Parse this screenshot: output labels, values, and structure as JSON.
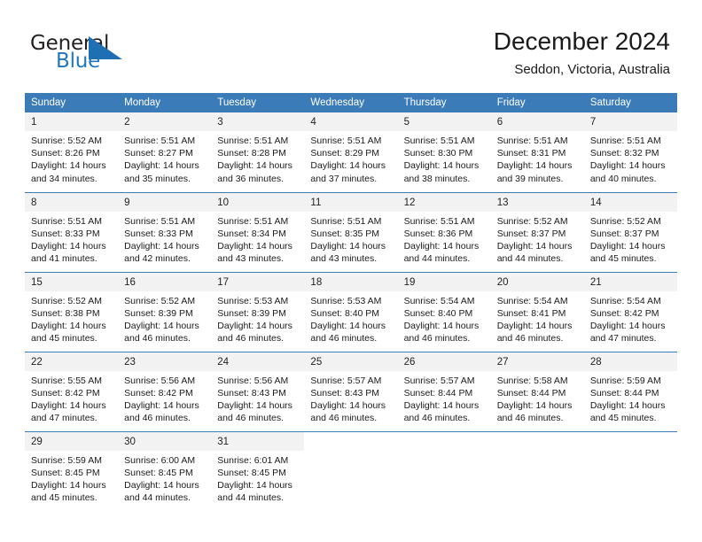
{
  "brand": {
    "name_part1": "General",
    "name_part2": "Blue",
    "accent_color": "#1f77c0",
    "triangle_icon": "triangle-icon"
  },
  "header": {
    "title": "December 2024",
    "location": "Seddon, Victoria, Australia"
  },
  "calendar": {
    "header_bg": "#3b7cb8",
    "daynum_bg": "#f2f2f2",
    "weekdays": [
      "Sunday",
      "Monday",
      "Tuesday",
      "Wednesday",
      "Thursday",
      "Friday",
      "Saturday"
    ],
    "weeks": [
      [
        {
          "day": "1",
          "sunrise": "Sunrise: 5:52 AM",
          "sunset": "Sunset: 8:26 PM",
          "daylight1": "Daylight: 14 hours",
          "daylight2": "and 34 minutes."
        },
        {
          "day": "2",
          "sunrise": "Sunrise: 5:51 AM",
          "sunset": "Sunset: 8:27 PM",
          "daylight1": "Daylight: 14 hours",
          "daylight2": "and 35 minutes."
        },
        {
          "day": "3",
          "sunrise": "Sunrise: 5:51 AM",
          "sunset": "Sunset: 8:28 PM",
          "daylight1": "Daylight: 14 hours",
          "daylight2": "and 36 minutes."
        },
        {
          "day": "4",
          "sunrise": "Sunrise: 5:51 AM",
          "sunset": "Sunset: 8:29 PM",
          "daylight1": "Daylight: 14 hours",
          "daylight2": "and 37 minutes."
        },
        {
          "day": "5",
          "sunrise": "Sunrise: 5:51 AM",
          "sunset": "Sunset: 8:30 PM",
          "daylight1": "Daylight: 14 hours",
          "daylight2": "and 38 minutes."
        },
        {
          "day": "6",
          "sunrise": "Sunrise: 5:51 AM",
          "sunset": "Sunset: 8:31 PM",
          "daylight1": "Daylight: 14 hours",
          "daylight2": "and 39 minutes."
        },
        {
          "day": "7",
          "sunrise": "Sunrise: 5:51 AM",
          "sunset": "Sunset: 8:32 PM",
          "daylight1": "Daylight: 14 hours",
          "daylight2": "and 40 minutes."
        }
      ],
      [
        {
          "day": "8",
          "sunrise": "Sunrise: 5:51 AM",
          "sunset": "Sunset: 8:33 PM",
          "daylight1": "Daylight: 14 hours",
          "daylight2": "and 41 minutes."
        },
        {
          "day": "9",
          "sunrise": "Sunrise: 5:51 AM",
          "sunset": "Sunset: 8:33 PM",
          "daylight1": "Daylight: 14 hours",
          "daylight2": "and 42 minutes."
        },
        {
          "day": "10",
          "sunrise": "Sunrise: 5:51 AM",
          "sunset": "Sunset: 8:34 PM",
          "daylight1": "Daylight: 14 hours",
          "daylight2": "and 43 minutes."
        },
        {
          "day": "11",
          "sunrise": "Sunrise: 5:51 AM",
          "sunset": "Sunset: 8:35 PM",
          "daylight1": "Daylight: 14 hours",
          "daylight2": "and 43 minutes."
        },
        {
          "day": "12",
          "sunrise": "Sunrise: 5:51 AM",
          "sunset": "Sunset: 8:36 PM",
          "daylight1": "Daylight: 14 hours",
          "daylight2": "and 44 minutes."
        },
        {
          "day": "13",
          "sunrise": "Sunrise: 5:52 AM",
          "sunset": "Sunset: 8:37 PM",
          "daylight1": "Daylight: 14 hours",
          "daylight2": "and 44 minutes."
        },
        {
          "day": "14",
          "sunrise": "Sunrise: 5:52 AM",
          "sunset": "Sunset: 8:37 PM",
          "daylight1": "Daylight: 14 hours",
          "daylight2": "and 45 minutes."
        }
      ],
      [
        {
          "day": "15",
          "sunrise": "Sunrise: 5:52 AM",
          "sunset": "Sunset: 8:38 PM",
          "daylight1": "Daylight: 14 hours",
          "daylight2": "and 45 minutes."
        },
        {
          "day": "16",
          "sunrise": "Sunrise: 5:52 AM",
          "sunset": "Sunset: 8:39 PM",
          "daylight1": "Daylight: 14 hours",
          "daylight2": "and 46 minutes."
        },
        {
          "day": "17",
          "sunrise": "Sunrise: 5:53 AM",
          "sunset": "Sunset: 8:39 PM",
          "daylight1": "Daylight: 14 hours",
          "daylight2": "and 46 minutes."
        },
        {
          "day": "18",
          "sunrise": "Sunrise: 5:53 AM",
          "sunset": "Sunset: 8:40 PM",
          "daylight1": "Daylight: 14 hours",
          "daylight2": "and 46 minutes."
        },
        {
          "day": "19",
          "sunrise": "Sunrise: 5:54 AM",
          "sunset": "Sunset: 8:40 PM",
          "daylight1": "Daylight: 14 hours",
          "daylight2": "and 46 minutes."
        },
        {
          "day": "20",
          "sunrise": "Sunrise: 5:54 AM",
          "sunset": "Sunset: 8:41 PM",
          "daylight1": "Daylight: 14 hours",
          "daylight2": "and 46 minutes."
        },
        {
          "day": "21",
          "sunrise": "Sunrise: 5:54 AM",
          "sunset": "Sunset: 8:42 PM",
          "daylight1": "Daylight: 14 hours",
          "daylight2": "and 47 minutes."
        }
      ],
      [
        {
          "day": "22",
          "sunrise": "Sunrise: 5:55 AM",
          "sunset": "Sunset: 8:42 PM",
          "daylight1": "Daylight: 14 hours",
          "daylight2": "and 47 minutes."
        },
        {
          "day": "23",
          "sunrise": "Sunrise: 5:56 AM",
          "sunset": "Sunset: 8:42 PM",
          "daylight1": "Daylight: 14 hours",
          "daylight2": "and 46 minutes."
        },
        {
          "day": "24",
          "sunrise": "Sunrise: 5:56 AM",
          "sunset": "Sunset: 8:43 PM",
          "daylight1": "Daylight: 14 hours",
          "daylight2": "and 46 minutes."
        },
        {
          "day": "25",
          "sunrise": "Sunrise: 5:57 AM",
          "sunset": "Sunset: 8:43 PM",
          "daylight1": "Daylight: 14 hours",
          "daylight2": "and 46 minutes."
        },
        {
          "day": "26",
          "sunrise": "Sunrise: 5:57 AM",
          "sunset": "Sunset: 8:44 PM",
          "daylight1": "Daylight: 14 hours",
          "daylight2": "and 46 minutes."
        },
        {
          "day": "27",
          "sunrise": "Sunrise: 5:58 AM",
          "sunset": "Sunset: 8:44 PM",
          "daylight1": "Daylight: 14 hours",
          "daylight2": "and 46 minutes."
        },
        {
          "day": "28",
          "sunrise": "Sunrise: 5:59 AM",
          "sunset": "Sunset: 8:44 PM",
          "daylight1": "Daylight: 14 hours",
          "daylight2": "and 45 minutes."
        }
      ],
      [
        {
          "day": "29",
          "sunrise": "Sunrise: 5:59 AM",
          "sunset": "Sunset: 8:45 PM",
          "daylight1": "Daylight: 14 hours",
          "daylight2": "and 45 minutes."
        },
        {
          "day": "30",
          "sunrise": "Sunrise: 6:00 AM",
          "sunset": "Sunset: 8:45 PM",
          "daylight1": "Daylight: 14 hours",
          "daylight2": "and 44 minutes."
        },
        {
          "day": "31",
          "sunrise": "Sunrise: 6:01 AM",
          "sunset": "Sunset: 8:45 PM",
          "daylight1": "Daylight: 14 hours",
          "daylight2": "and 44 minutes."
        },
        {
          "day": "",
          "sunrise": "",
          "sunset": "",
          "daylight1": "",
          "daylight2": ""
        },
        {
          "day": "",
          "sunrise": "",
          "sunset": "",
          "daylight1": "",
          "daylight2": ""
        },
        {
          "day": "",
          "sunrise": "",
          "sunset": "",
          "daylight1": "",
          "daylight2": ""
        },
        {
          "day": "",
          "sunrise": "",
          "sunset": "",
          "daylight1": "",
          "daylight2": ""
        }
      ]
    ]
  }
}
